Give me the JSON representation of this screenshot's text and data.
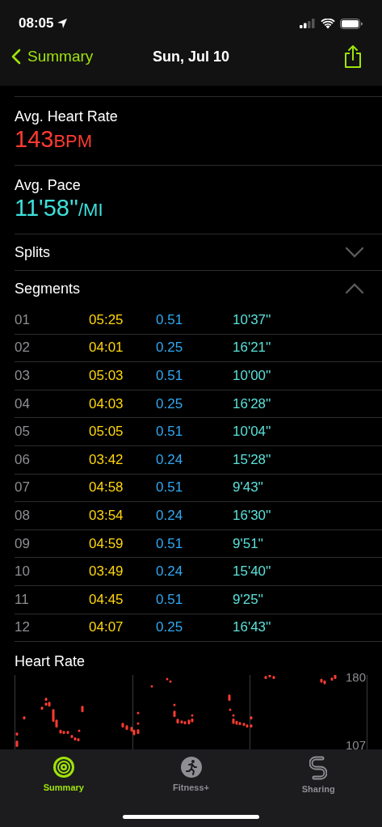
{
  "status_bar": {
    "time": "08:05"
  },
  "nav": {
    "back": "Summary",
    "title": "Sun, Jul 10"
  },
  "metrics": [
    {
      "label": "Avg. Heart Rate",
      "value": "143",
      "unit": "BPM",
      "kind": "heart"
    },
    {
      "label": "Avg. Pace",
      "value": "11'58''",
      "unit": "/MI",
      "kind": "pace"
    }
  ],
  "sections": [
    {
      "title": "Splits",
      "expanded": false
    },
    {
      "title": "Segments",
      "expanded": true
    }
  ],
  "segments": [
    [
      "01",
      "05:25",
      "0.51",
      "10'37''"
    ],
    [
      "02",
      "04:01",
      "0.25",
      "16'21''"
    ],
    [
      "03",
      "05:03",
      "0.51",
      "10'00''"
    ],
    [
      "04",
      "04:03",
      "0.25",
      "16'28''"
    ],
    [
      "05",
      "05:05",
      "0.51",
      "10'04''"
    ],
    [
      "06",
      "03:42",
      "0.24",
      "15'28''"
    ],
    [
      "07",
      "04:58",
      "0.51",
      "9'43''"
    ],
    [
      "08",
      "03:54",
      "0.24",
      "16'30''"
    ],
    [
      "09",
      "04:59",
      "0.51",
      "9'51''"
    ],
    [
      "10",
      "03:49",
      "0.24",
      "15'40''"
    ],
    [
      "11",
      "04:45",
      "0.51",
      "9'25''"
    ],
    [
      "12",
      "04:07",
      "0.25",
      "16'43''"
    ]
  ],
  "heart_rate": {
    "title": "Heart Rate",
    "axis_labels": [
      "180",
      "107"
    ]
  },
  "tabs": [
    {
      "label": "Summary",
      "selected": true,
      "kind": "rings"
    },
    {
      "label": "Fitness+",
      "selected": false,
      "kind": "runner"
    },
    {
      "label": "Sharing",
      "selected": false,
      "kind": "sharing"
    }
  ]
}
